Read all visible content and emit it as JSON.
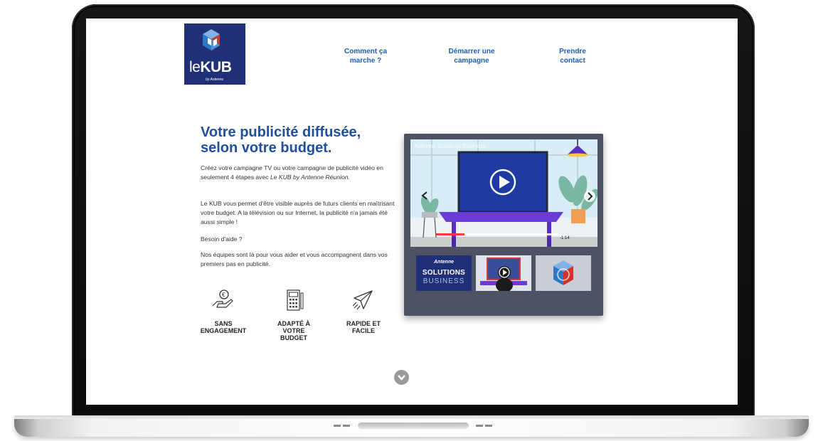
{
  "logo": {
    "le": "le",
    "kub": "KUB",
    "sub": "by Antenne"
  },
  "nav": [
    {
      "line1": "Comment ça",
      "line2": "marche ?"
    },
    {
      "line1": "Démarrer une",
      "line2": "campagne"
    },
    {
      "line1": "Prendre",
      "line2": "contact"
    }
  ],
  "hero": {
    "title_line1": "Votre publicité diffusée,",
    "title_line2": "selon votre budget.",
    "p1_before": "Créez votre campagne TV ou votre campagne de publicité vidéo en seulement 4 étapes avec ",
    "p1_em": "Le KUB by Antenne Réunion.",
    "p2": "Le KUB vous permet d'être visible auprès de futurs clients en maîtrisant votre budget. A la télévision ou sur Internet, la publicité n'a jamais été aussi simple !",
    "p3": "Besoin d'aide ?",
    "p4": "Nos équipes sont là pour vous aider et vous accompagnent dans vos premiers pas en publicité."
  },
  "features": [
    {
      "icon": "euro-hand-icon",
      "line1": "SANS",
      "line2": "ENGAGEMENT",
      "line3": ""
    },
    {
      "icon": "calculator-icon",
      "line1": "ADAPTÉ À",
      "line2": "VOTRE",
      "line3": "BUDGET"
    },
    {
      "icon": "paper-plane-icon",
      "line1": "RAPIDE ET",
      "line2": "FACILE",
      "line3": ""
    }
  ],
  "video": {
    "title": "Antenne Solutions Business",
    "time": "-1:14",
    "thumb1_brand": "Antenne",
    "thumb1_line1": "SOLUTIONS",
    "thumb1_line2": "BUSINESS"
  },
  "colors": {
    "brand_blue": "#1f4f9f",
    "nav_blue": "#1d5fb8",
    "logo_bg": "#1f2f78",
    "panel_bg": "#4d5264",
    "purple": "#5a2fc4"
  }
}
